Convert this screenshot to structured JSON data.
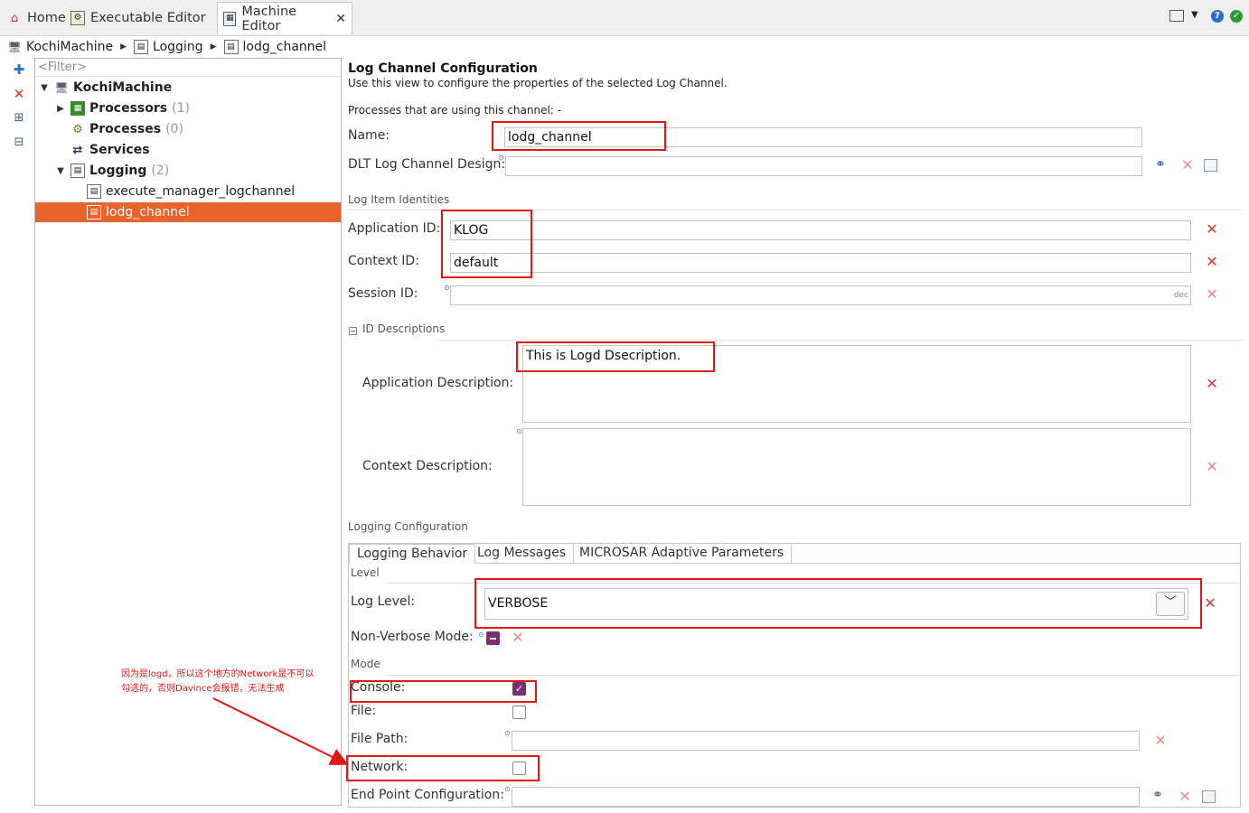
{
  "tabs": [
    {
      "label": "Home",
      "icon": "home-icon"
    },
    {
      "label": "Executable Editor",
      "icon": "executable-editor-icon"
    },
    {
      "label": "Machine Editor",
      "icon": "machine-editor-icon"
    }
  ],
  "breadcrumb": [
    "KochiMachine",
    "Logging",
    "lodg_channel"
  ],
  "tree": {
    "filter_placeholder": "<Filter>",
    "root": "KochiMachine",
    "items": [
      {
        "label": "Processors",
        "count": "(1)"
      },
      {
        "label": "Processes",
        "count": "(0)"
      },
      {
        "label": "Services",
        "count": ""
      },
      {
        "label": "Logging",
        "count": "(2)"
      },
      {
        "label": "execute_manager_logchannel",
        "count": ""
      },
      {
        "label": "lodg_channel",
        "count": ""
      }
    ]
  },
  "form": {
    "title": "Log Channel Configuration",
    "description": "Use this view to configure the properties of the selected Log Channel.",
    "processes_text": "Processes that are using this channel: -",
    "name_label": "Name:",
    "name_value": "lodg_channel",
    "dlt_label": "DLT Log Channel Design:",
    "dlt_value": "",
    "identities_header": "Log Item Identities",
    "app_id_label": "Application ID:",
    "app_id_value": "KLOG",
    "ctx_id_label": "Context ID:",
    "ctx_id_value": "default",
    "session_id_label": "Session ID:",
    "session_id_suffix": "dec",
    "desc_header": "ID Descriptions",
    "app_desc_label": "Application Description:",
    "app_desc_value": "This is Logd Dsecription.",
    "ctx_desc_label": "Context Description:",
    "ctx_desc_value": "",
    "logging_header": "Logging Configuration",
    "subtabs": [
      "Logging Behavior",
      "Log Messages",
      "MICROSAR Adaptive Parameters"
    ],
    "level_header": "Level",
    "log_level_label": "Log Level:",
    "log_level_value": "VERBOSE",
    "non_verbose_label": "Non-Verbose Mode:",
    "mode_header": "Mode",
    "console_label": "Console:",
    "file_label": "File:",
    "file_path_label": "File Path:",
    "network_label": "Network:",
    "endpoint_label": "End Point Configuration:"
  },
  "annotation": {
    "line1": "因为是logd，所以这个地方的Network是不可以",
    "line2": "勾选的，否则Davince会报错，无法生成"
  },
  "colors": {
    "selection": "#e8642b",
    "annotation_red": "#e01818",
    "checkbox": "#7a2f6e"
  }
}
